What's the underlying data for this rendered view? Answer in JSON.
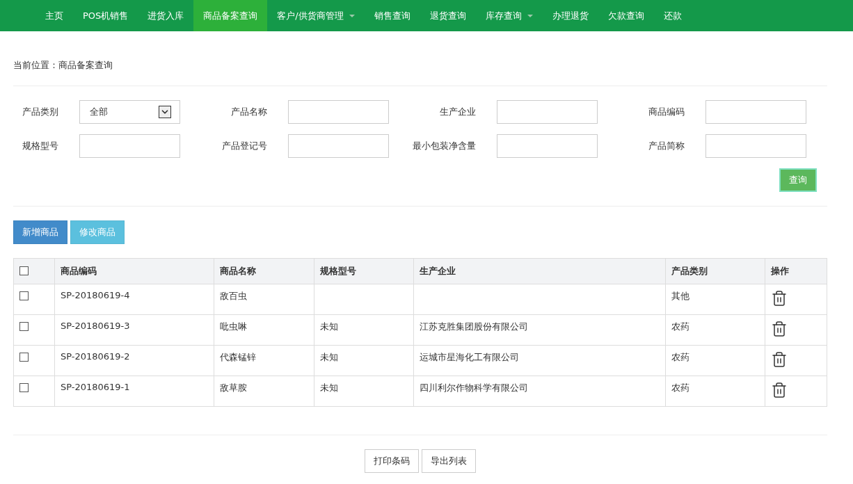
{
  "nav": {
    "items": [
      {
        "label": "主页",
        "selected": false,
        "dropdown": false
      },
      {
        "label": "POS机销售",
        "selected": false,
        "dropdown": false
      },
      {
        "label": "进货入库",
        "selected": false,
        "dropdown": false
      },
      {
        "label": "商品备案查询",
        "selected": true,
        "dropdown": false
      },
      {
        "label": "客户/供货商管理",
        "selected": false,
        "dropdown": true
      },
      {
        "label": "销售查询",
        "selected": false,
        "dropdown": false
      },
      {
        "label": "退货查询",
        "selected": false,
        "dropdown": false
      },
      {
        "label": "库存查询",
        "selected": false,
        "dropdown": true
      },
      {
        "label": "办理退货",
        "selected": false,
        "dropdown": false
      },
      {
        "label": "欠款查询",
        "selected": false,
        "dropdown": false
      },
      {
        "label": "还款",
        "selected": false,
        "dropdown": false
      }
    ]
  },
  "breadcrumb": "当前位置：商品备案查询",
  "filters": [
    {
      "kind": "select",
      "label": "产品类别",
      "value": "全部"
    },
    {
      "kind": "input",
      "label": "产品名称"
    },
    {
      "kind": "input",
      "label": "生产企业"
    },
    {
      "kind": "input",
      "label": "商品编码"
    },
    {
      "kind": "input",
      "label": "规格型号"
    },
    {
      "kind": "input",
      "label": "产品登记号"
    },
    {
      "kind": "input",
      "label": "最小包装净含量"
    },
    {
      "kind": "input",
      "label": "产品简称"
    }
  ],
  "search_button": "查询",
  "actions": [
    {
      "label": "新增商品",
      "kind": "primary"
    },
    {
      "label": "修改商品",
      "kind": "info"
    }
  ],
  "table": {
    "select_all": {
      "checked": false
    },
    "columns": [
      "商品编码",
      "商品名称",
      "规格型号",
      "生产企业",
      "产品类别",
      "操作"
    ],
    "rows": [
      {
        "checked": false,
        "cells": [
          "SP-20180619-4",
          "敌百虫",
          "",
          "",
          "其他"
        ]
      },
      {
        "checked": false,
        "cells": [
          "SP-20180619-3",
          "吡虫啉",
          "未知",
          "江苏克胜集团股份有限公司",
          "农药"
        ]
      },
      {
        "checked": false,
        "cells": [
          "SP-20180619-2",
          "代森锰锌",
          "未知",
          "运城市星海化工有限公司",
          "农药"
        ]
      },
      {
        "checked": false,
        "cells": [
          "SP-20180619-1",
          "敌草胺",
          "未知",
          "四川利尔作物科学有限公司",
          "农药"
        ]
      }
    ]
  },
  "footer_buttons": [
    "打印条码",
    "导出列表"
  ]
}
